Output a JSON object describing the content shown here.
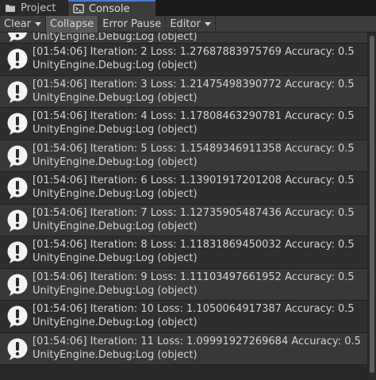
{
  "tabs": [
    {
      "label": "Project",
      "icon": "folder-icon"
    },
    {
      "label": "Console",
      "icon": "console-icon"
    }
  ],
  "toolbar": {
    "clear_label": "Clear",
    "collapse_label": "Collapse",
    "error_pause_label": "Error Pause",
    "editor_label": "Editor"
  },
  "log": {
    "partial_line2": "UnityEngine.Debug:Log (object)",
    "entries": [
      {
        "line1": "[01:54:06] Iteration: 2 Loss: 1.27687883975769 Accuracy: 0.5",
        "line2": "UnityEngine.Debug:Log (object)"
      },
      {
        "line1": "[01:54:06] Iteration: 3 Loss: 1.21475498390772 Accuracy: 0.5",
        "line2": "UnityEngine.Debug:Log (object)"
      },
      {
        "line1": "[01:54:06] Iteration: 4 Loss: 1.17808463290781 Accuracy: 0.5",
        "line2": "UnityEngine.Debug:Log (object)"
      },
      {
        "line1": "[01:54:06] Iteration: 5 Loss: 1.15489346911358 Accuracy: 0.5",
        "line2": "UnityEngine.Debug:Log (object)"
      },
      {
        "line1": "[01:54:06] Iteration: 6 Loss: 1.13901917201208 Accuracy: 0.5",
        "line2": "UnityEngine.Debug:Log (object)"
      },
      {
        "line1": "[01:54:06] Iteration: 7 Loss: 1.12735905487436 Accuracy: 0.5",
        "line2": "UnityEngine.Debug:Log (object)"
      },
      {
        "line1": "[01:54:06] Iteration: 8 Loss: 1.11831869450032 Accuracy: 0.5",
        "line2": "UnityEngine.Debug:Log (object)"
      },
      {
        "line1": "[01:54:06] Iteration: 9 Loss: 1.11103497661952 Accuracy: 0.5",
        "line2": "UnityEngine.Debug:Log (object)"
      },
      {
        "line1": "[01:54:06] Iteration: 10 Loss: 1.1050064917387 Accuracy: 0.5",
        "line2": "UnityEngine.Debug:Log (object)"
      },
      {
        "line1": "[01:54:06] Iteration: 11 Loss: 1.09991927269684 Accuracy: 0.5",
        "line2": "UnityEngine.Debug:Log (object)"
      }
    ]
  },
  "colors": {
    "accent": "#4a7bd4",
    "background": "#282828",
    "row_odd": "#2e2e2e",
    "row_even": "#383838"
  }
}
